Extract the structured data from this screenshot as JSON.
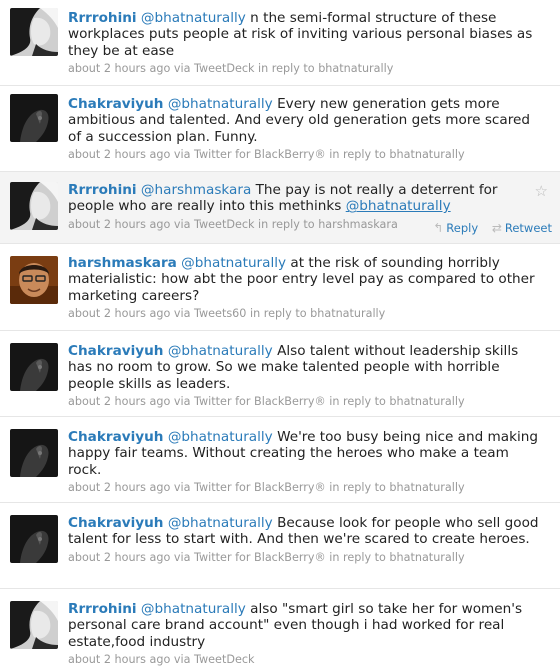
{
  "tweets": [
    {
      "user": "Rrrrohini",
      "mention": "@bhatnaturally",
      "text": "n the semi-formal structure of these workplaces puts people at risk of inviting various personal biases as they be at ease",
      "time": "about 2 hours ago",
      "via": "via",
      "client": "TweetDeck",
      "reply_prefix": "in reply to",
      "reply_to": "bhatnaturally",
      "avatar_icon": "woman-profile-avatar"
    },
    {
      "user": "Chakraviyuh",
      "mention": "@bhatnaturally",
      "text": "Every new generation gets more ambitious and talented. And every old generation gets more scared of a succession plan. Funny.",
      "time": "about 2 hours ago",
      "via": "via",
      "client": "Twitter for BlackBerry®",
      "reply_prefix": "in reply to",
      "reply_to": "bhatnaturally",
      "avatar_icon": "dark-hand-avatar"
    },
    {
      "user": "Rrrrohini",
      "mention": "@harshmaskara",
      "text": "The pay is not really a deterrent for people who are really into this methinks",
      "trailing_link": "@bhatnaturally",
      "time": "about 2 hours ago",
      "via": "via",
      "client": "TweetDeck",
      "reply_prefix": "in reply to",
      "reply_to": "harshmaskara",
      "avatar_icon": "woman-profile-avatar",
      "actions": {
        "reply": "Reply",
        "retweet": "Retweet",
        "star_icon": "star-icon"
      }
    },
    {
      "user": "harshmaskara",
      "mention": "@bhatnaturally",
      "text": "at the risk of sounding horribly materialistic: how abt the poor entry level pay as compared to other marketing careers?",
      "time": "about 2 hours ago",
      "via": "via",
      "client": "Tweets60",
      "reply_prefix": "in reply to",
      "reply_to": "bhatnaturally",
      "avatar_icon": "man-face-avatar"
    },
    {
      "user": "Chakraviyuh",
      "mention": "@bhatnaturally",
      "text": "Also talent without leadership skills has no room to grow. So we make talented people with horrible people skills as leaders.",
      "time": "about 2 hours ago",
      "via": "via",
      "client": "Twitter for BlackBerry®",
      "reply_prefix": "in reply to",
      "reply_to": "bhatnaturally",
      "avatar_icon": "dark-hand-avatar"
    },
    {
      "user": "Chakraviyuh",
      "mention": "@bhatnaturally",
      "text": "We're too busy being nice and making happy fair teams. Without creating the heroes who make a team rock.",
      "time": "about 2 hours ago",
      "via": "via",
      "client": "Twitter for BlackBerry®",
      "reply_prefix": "in reply to",
      "reply_to": "bhatnaturally",
      "avatar_icon": "dark-hand-avatar"
    },
    {
      "user": "Chakraviyuh",
      "mention": "@bhatnaturally",
      "text": "Because look for people who sell good talent for less to start with. And then we're scared to create heroes.",
      "time": "about 2 hours ago",
      "via": "via",
      "client": "Twitter for BlackBerry®",
      "reply_prefix": "in reply to",
      "reply_to": "bhatnaturally",
      "avatar_icon": "dark-hand-avatar"
    },
    {
      "user": "Rrrrohini",
      "mention": "@bhatnaturally",
      "text": "also \"smart girl so take her for women's personal care brand account\" even though i had worked for real estate,food industry",
      "time": "about 2 hours ago",
      "via": "via",
      "client": "TweetDeck",
      "avatar_icon": "woman-profile-avatar"
    }
  ],
  "colors": {
    "link": "#2b7bb9",
    "meta": "#999999",
    "highlight": "#f4f4f4"
  }
}
